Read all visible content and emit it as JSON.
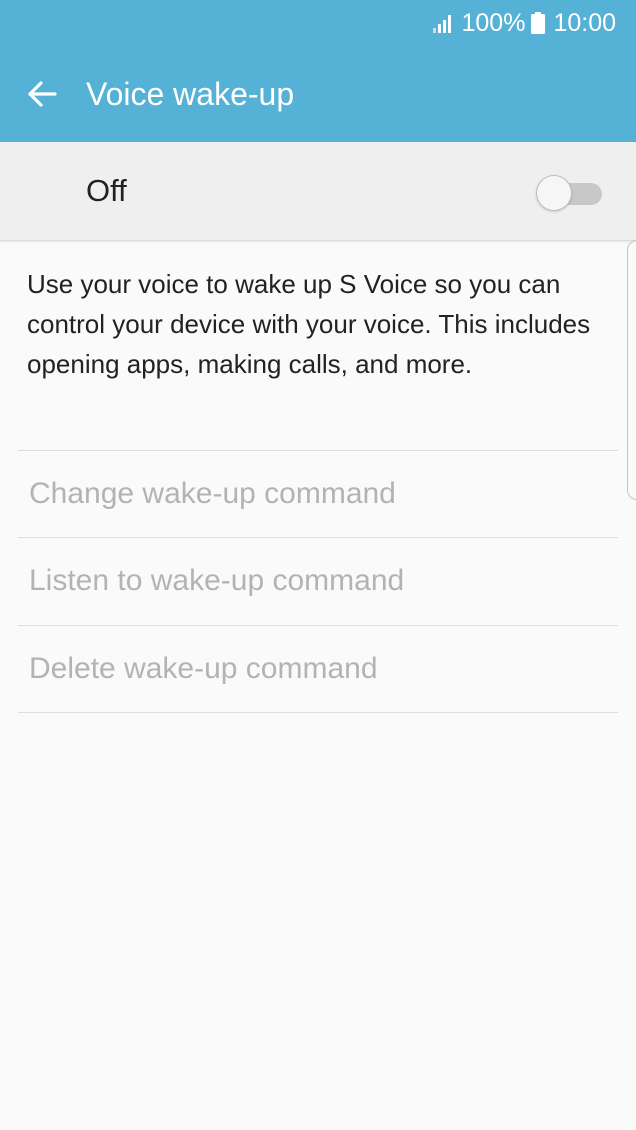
{
  "status_bar": {
    "battery_percent": "100%",
    "time": "10:00",
    "signal_icon": "signal-bars-icon",
    "battery_icon": "battery-icon"
  },
  "app_bar": {
    "back_icon": "arrow-left-icon",
    "title": "Voice wake-up"
  },
  "master_switch": {
    "label": "Off",
    "state": false
  },
  "description": "Use your voice to wake up S Voice so you can control your device with your voice. This includes opening apps, making calls, and more.",
  "options": [
    {
      "label": "Change wake-up command",
      "enabled": false
    },
    {
      "label": "Listen to wake-up command",
      "enabled": false
    },
    {
      "label": "Delete wake-up command",
      "enabled": false
    }
  ],
  "colors": {
    "accent": "#55b1d6",
    "disabled_text": "#b3b3b3",
    "background": "#fafafa"
  }
}
